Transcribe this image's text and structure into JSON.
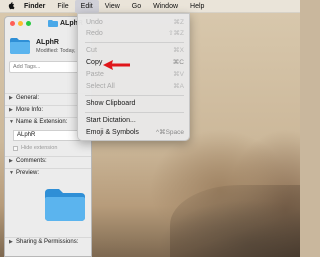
{
  "menubar": {
    "app": "Finder",
    "items": [
      "File",
      "Edit",
      "View",
      "Go",
      "Window",
      "Help"
    ]
  },
  "window": {
    "title": "ALphR",
    "file_name": "ALphR",
    "modified": "Modified: Today,",
    "tags_placeholder": "Add Tags...",
    "sections": {
      "general": "General:",
      "more_info": "More Info:",
      "name_ext": "Name & Extension:",
      "comments": "Comments:",
      "preview": "Preview:",
      "sharing": "Sharing & Permissions:"
    },
    "name_value": "ALphR",
    "hide_extension": "Hide extension"
  },
  "edit_menu": {
    "undo": {
      "label": "Undo",
      "shortcut": "⌘Z"
    },
    "redo": {
      "label": "Redo",
      "shortcut": "⇧⌘Z"
    },
    "cut": {
      "label": "Cut",
      "shortcut": "⌘X"
    },
    "copy": {
      "label": "Copy",
      "shortcut": "⌘C"
    },
    "paste": {
      "label": "Paste",
      "shortcut": "⌘V"
    },
    "select_all": {
      "label": "Select All",
      "shortcut": "⌘A"
    },
    "show_clipboard": {
      "label": "Show Clipboard"
    },
    "start_dictation": {
      "label": "Start Dictation..."
    },
    "emoji_symbols": {
      "label": "Emoji & Symbols",
      "shortcut": "^⌘Space"
    }
  },
  "colors": {
    "arrow": "#e0161b",
    "folder": "#4aa8e8"
  }
}
